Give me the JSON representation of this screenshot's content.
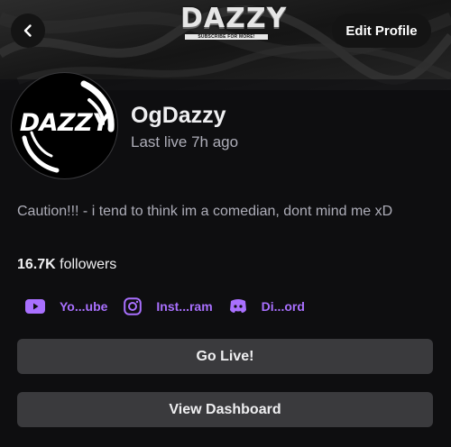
{
  "banner": {
    "logo_text": "DAZZY",
    "logo_tagline": "SUBSCRIBE FOR MORE!"
  },
  "header": {
    "back_icon": "chevron-left-icon",
    "edit_profile_label": "Edit Profile"
  },
  "profile": {
    "avatar_text": "DAZZY",
    "username": "OgDazzy",
    "last_live": "Last live 7h ago",
    "bio": "Caution!!! - i tend to think im a comedian, dont mind me xD",
    "followers_count": "16.7K",
    "followers_label": "followers"
  },
  "socials": [
    {
      "icon": "youtube-icon",
      "label": "Yo...ube"
    },
    {
      "icon": "instagram-icon",
      "label": "Inst...ram"
    },
    {
      "icon": "discord-icon",
      "label": "Di...ord"
    }
  ],
  "actions": {
    "go_live_label": "Go Live!",
    "view_dashboard_label": "View Dashboard"
  },
  "colors": {
    "background": "#0e0e10",
    "accent": "#a970ff",
    "button": "#3a3a3d",
    "secondary_text": "#adadb8"
  }
}
